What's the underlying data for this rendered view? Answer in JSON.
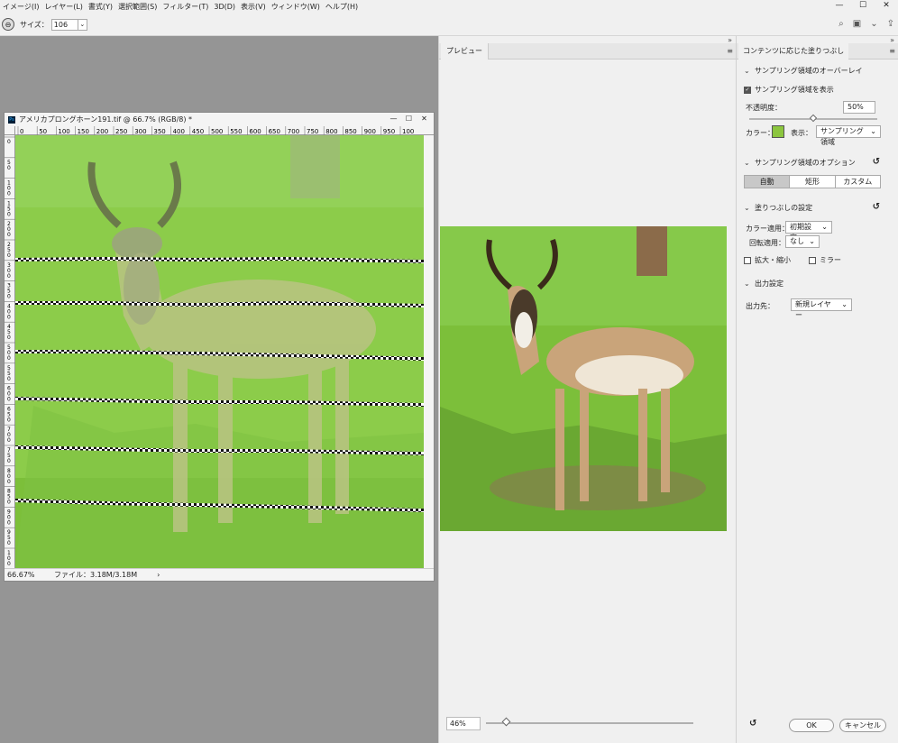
{
  "menu": [
    "イメージ(I)",
    "レイヤー(L)",
    "書式(Y)",
    "選択範囲(S)",
    "フィルター(T)",
    "3D(D)",
    "表示(V)",
    "ウィンドウ(W)",
    "ヘルプ(H)"
  ],
  "window_controls": {
    "minimize": "—",
    "maximize": "☐",
    "close": "✕"
  },
  "options": {
    "size_label": "サイズ：",
    "size_value": "106",
    "dropdown": "⌄",
    "tool_glyph": "⊖"
  },
  "opt_icons": {
    "search": "⌕",
    "layout": "▣",
    "layout_dd": "⌄",
    "share": "⇪"
  },
  "document": {
    "title": "アメリカプロングホーン191.tif @ 66.7% (RGB/8) *",
    "ps_badge": "Ps",
    "controls": {
      "minimize": "—",
      "maximize": "☐",
      "close": "✕"
    },
    "ruler_ticks": [
      "0",
      "50",
      "100",
      "150",
      "200",
      "250",
      "300",
      "350",
      "400",
      "450",
      "500",
      "550",
      "600",
      "650",
      "700",
      "750",
      "800",
      "850",
      "900",
      "950",
      "100"
    ],
    "vruler_ticks": [
      "0",
      "5\n0",
      "1\n0\n0",
      "1\n5\n0",
      "2\n0\n0",
      "2\n5\n0",
      "3\n0\n0",
      "3\n5\n0",
      "4\n0\n0",
      "4\n5\n0",
      "5\n0\n0",
      "5\n5\n0",
      "6\n0\n0",
      "6\n5\n0",
      "7\n0\n0",
      "7\n5\n0",
      "8\n0\n0",
      "8\n5\n0",
      "9\n0\n0",
      "9\n5\n0",
      "1\n0\n0"
    ],
    "zoom": "66.67%",
    "file_info": "ファイル：3.18M/3.18M",
    "status_arrow": "›"
  },
  "preview": {
    "tab": "プレビュー",
    "zoom": "46%",
    "collapse": "»",
    "panel_menu": "≡"
  },
  "settings": {
    "tab": "コンテンツに応じた塗りつぶし",
    "collapse": "»",
    "panel_menu": "≡",
    "chevron": "⌄",
    "section_overlay": "サンプリング領域のオーバーレイ",
    "show_sampling_label": "サンプリング領域を表示",
    "checkmark": "✓",
    "opacity_label": "不透明度：",
    "opacity_value": "50%",
    "color_label": "カラー：",
    "color_swatch": "#8cc63f",
    "display_label": "表示：",
    "display_value": "サンプリング領域",
    "section_options": "サンプリング領域のオプション",
    "reset_icon": "↺",
    "options_buttons": [
      "自動",
      "矩形",
      "カスタム"
    ],
    "options_active": 0,
    "section_fill": "塗りつぶしの設定",
    "color_adapt_label": "カラー適用：",
    "color_adapt_value": "初期設定",
    "rotation_label": "回転適用：",
    "rotation_value": "なし",
    "scale_label": "拡大・縮小",
    "mirror_label": "ミラー",
    "section_output": "出力設定",
    "output_label": "出力先：",
    "output_value": "新規レイヤー",
    "ok": "OK",
    "cancel": "キャンセル"
  }
}
